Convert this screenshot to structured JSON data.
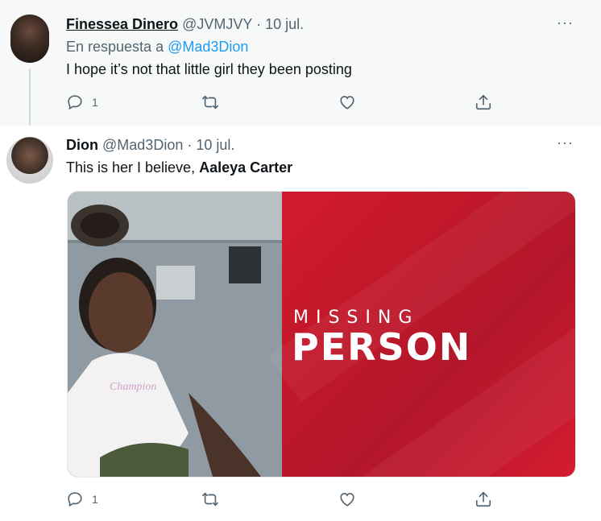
{
  "tweets": [
    {
      "display_name": "Finessea Dinero",
      "handle": "@JVMJVY",
      "separator": "·",
      "date": "10 jul.",
      "reply_prefix": "En respuesta a",
      "reply_mention": "@Mad3Dion",
      "text": "I hope it’s not that little girl they been posting",
      "reply_count": "1",
      "more_label": "···"
    },
    {
      "display_name": "Dion",
      "handle": "@Mad3Dion",
      "separator": "·",
      "date": "10 jul.",
      "text_plain": "This is her I believe, ",
      "text_bold": "Aaleya Carter",
      "reply_count": "1",
      "more_label": "···",
      "media": {
        "line1": "MISSING",
        "line2": "PERSON",
        "shirt_text": "Champion"
      }
    }
  ],
  "icons": [
    "reply-icon",
    "retweet-icon",
    "like-icon",
    "share-icon",
    "more-icon"
  ],
  "colors": {
    "accent": "#1d9bf0",
    "secondary_text": "#536471",
    "missing_red": "#d21a2d",
    "reply_bg": "#f7f9f9"
  }
}
